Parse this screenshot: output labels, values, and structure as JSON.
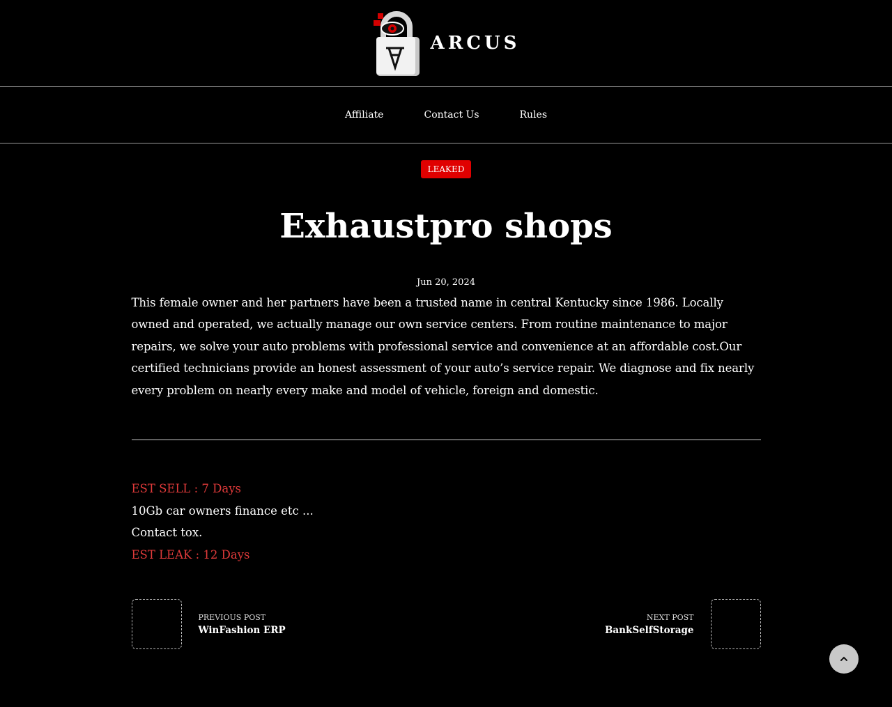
{
  "site": {
    "title": "ARCUS"
  },
  "nav": {
    "items": [
      {
        "label": "Affiliate"
      },
      {
        "label": "Contact Us"
      },
      {
        "label": "Rules"
      }
    ]
  },
  "post": {
    "category": "LEAKED",
    "title": "Exhaustpro shops",
    "date": "Jun 20, 2024",
    "body": "This female owner and her partners have been a trusted name in central Kentucky since 1986. Locally owned and operated, we actually manage our own service centers. From routine maintenance to major repairs, we solve your auto problems with professional service and convenience at an affordable cost.Our certified technicians provide an honest assessment of your auto’s service repair. We diagnose and fix nearly every problem on nearly every make and model of vehicle, foreign and domestic.",
    "est_sell": "EST SELL : 7 Days",
    "size_line": "10Gb car owners finance etc ...",
    "contact_line": "Contact tox.",
    "est_leak": "EST LEAK : 12 Days"
  },
  "post_nav": {
    "previous_label": "PREVIOUS POST",
    "previous_title": "WinFashion ERP",
    "next_label": "NEXT POST",
    "next_title": "BankSelfStorage"
  },
  "colors": {
    "accent_red": "#e00000",
    "text_red": "#e03a3a",
    "background": "#000000"
  },
  "icons": {
    "logo": "padlock-eye-logo-icon",
    "scroll_top": "chevron-up-icon"
  }
}
